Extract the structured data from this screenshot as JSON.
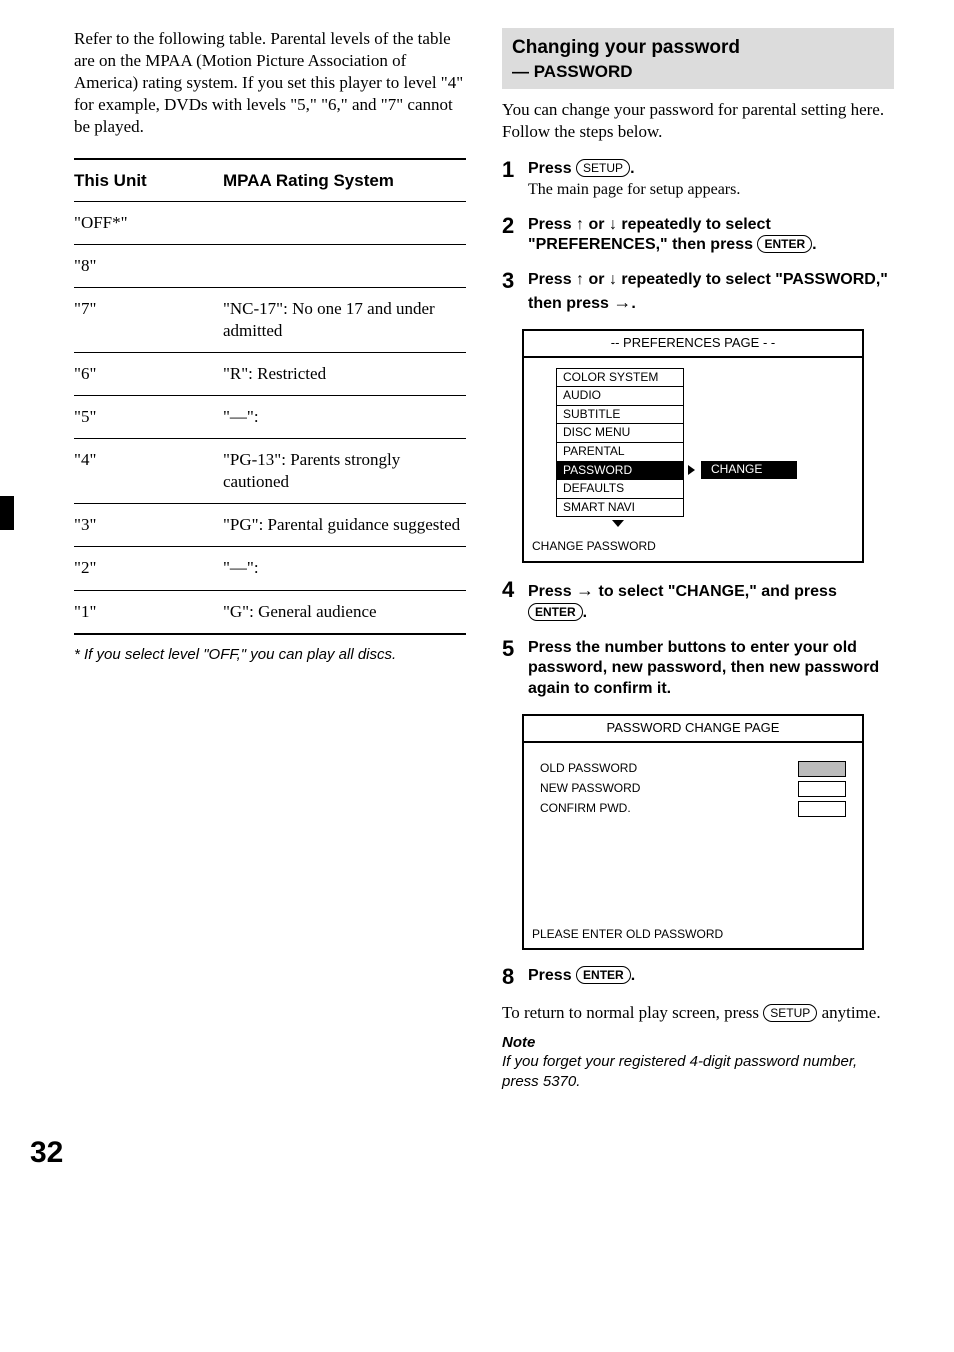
{
  "left": {
    "intro": "Refer to the following table. Parental levels of the table are on the MPAA (Motion Picture Association of America) rating system. If you set this player to level \"4\" for example, DVDs with levels \"5,\" \"6,\" and \"7\" cannot be played.",
    "table": {
      "h1": "This Unit",
      "h2": "MPAA Rating System",
      "rows": [
        {
          "c1": "\"OFF*\"",
          "c2": ""
        },
        {
          "c1": "\"8\"",
          "c2": ""
        },
        {
          "c1": "\"7\"",
          "c2": "\"NC-17\": No one 17 and under admitted"
        },
        {
          "c1": "\"6\"",
          "c2": "\"R\": Restricted"
        },
        {
          "c1": "\"5\"",
          "c2": "\"—\":"
        },
        {
          "c1": "\"4\"",
          "c2": "\"PG-13\": Parents strongly cautioned"
        },
        {
          "c1": "\"3\"",
          "c2": "\"PG\": Parental guidance suggested"
        },
        {
          "c1": "\"2\"",
          "c2": "\"—\":"
        },
        {
          "c1": "\"1\"",
          "c2": "\"G\": General audience"
        }
      ]
    },
    "footnote": "* If you select level \"OFF,\" you can play all discs."
  },
  "right": {
    "header": {
      "t1": "Changing your password",
      "t2": "— PASSWORD"
    },
    "intro": "You can change your password for parental setting here. Follow the steps below.",
    "steps": {
      "s1": {
        "n": "1",
        "b1": "Press ",
        "key": "SETUP",
        "b2": ".",
        "sub": "The main page for setup appears."
      },
      "s2": {
        "n": "2",
        "b1": "Press ",
        "b2": " or ",
        "b3": " repeatedly to select \"PREFERENCES,\" then press ",
        "key": "ENTER",
        "b4": "."
      },
      "s3": {
        "n": "3",
        "b1": "Press ",
        "b2": " or ",
        "b3": " repeatedly to select \"PASSWORD,\" then press ",
        "b4": "."
      },
      "s4": {
        "n": "4",
        "b1": "Press ",
        "b2": " to select \"CHANGE,\" and press ",
        "key": "ENTER",
        "b3": "."
      },
      "s5": {
        "n": "5",
        "b1": "Press the number buttons to enter your old password, new password, then new password again to confirm it."
      },
      "s8": {
        "n": "8",
        "b1": "Press ",
        "key": "ENTER",
        "b2": "."
      }
    },
    "osd1": {
      "title": "-- PREFERENCES PAGE - -",
      "items": [
        "COLOR SYSTEM",
        "AUDIO",
        "SUBTITLE",
        "DISC  MENU",
        "PARENTAL",
        "PASSWORD",
        "DEFAULTS",
        "SMART NAVI"
      ],
      "change": "CHANGE",
      "footer": "CHANGE PASSWORD"
    },
    "osd2": {
      "title": "PASSWORD CHANGE PAGE",
      "r1": "OLD PASSWORD",
      "r2": "NEW PASSWORD",
      "r3": "CONFIRM PWD.",
      "footer": "PLEASE ENTER OLD PASSWORD"
    },
    "return_text1": "To return to normal play screen, press ",
    "return_key": "SETUP",
    "return_text2": " anytime.",
    "note_label": "Note",
    "note_body": "If you forget your registered 4-digit password number, press 5370."
  },
  "page_number": "32"
}
